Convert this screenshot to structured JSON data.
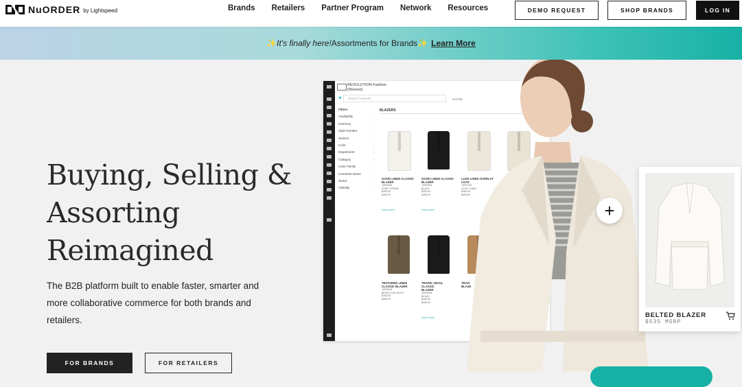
{
  "header": {
    "logo_text": "NuORDER",
    "logo_sub": "by Lightspeed",
    "nav": [
      "Brands",
      "Retailers",
      "Partner Program",
      "Network",
      "Resources"
    ],
    "demo_request": "DEMO REQUEST",
    "shop_brands": "SHOP BRANDS",
    "log_in": "LOG IN"
  },
  "banner": {
    "italic": "It's finally here!",
    "text": " Assortments for Brands",
    "learn_more": "Learn More"
  },
  "hero": {
    "title_lines": [
      "Buying, Selling &",
      "Assorting",
      "Reimagined"
    ],
    "subtitle": "The B2B platform built to enable faster, smarter and more collaborative commerce for both brands and retailers.",
    "for_brands": "FOR BRANDS",
    "for_retailers": "FOR RETAILERS"
  },
  "mock": {
    "store_line1": "REVOLUTION Fashion",
    "store_line2": "(Women)",
    "search_placeholder": "Search Products",
    "sort_by": "Sort By",
    "filters_label": "Filters",
    "filters": [
      "Availability",
      "Inventory",
      "Style Number",
      "Season",
      "Color",
      "Department",
      "Category",
      "Color Family",
      "Linesheet Name",
      "Status",
      "Visibility"
    ],
    "section": "BLAZERS",
    "products": [
      {
        "name1": "GOOD LINEN CLASSIC",
        "name2": "BLAZER",
        "sku": "J0000001",
        "color": "SHIRT CREAM",
        "wholesale": "$250.00",
        "msrp": "$495.00",
        "link": "more colors",
        "swatch": "#f4f1ea"
      },
      {
        "name1": "GOOD LINEN CLASSIC",
        "name2": "BLAZER",
        "sku": "J0000001",
        "color": "BLACK",
        "wholesale": "$250.00",
        "msrp": "$495.00",
        "link": "more colors",
        "swatch": "#1b1b1b"
      },
      {
        "name1": "LUXE LINEN OVERLAY",
        "name2": "COAT",
        "sku": "J0007001",
        "color": "LIGHT LINEN",
        "wholesale": "$250.00",
        "msrp": "$495.00",
        "link": "",
        "swatch": "#ece7d8"
      },
      {
        "name1": "",
        "name2": "",
        "sku": "",
        "color": "",
        "wholesale": "",
        "msrp": "",
        "link": "",
        "swatch": "#e8e3d3"
      },
      {
        "name1": "TEXTURED LINEN",
        "name2": "CLASSIC BLAZER",
        "sku": "J0000001",
        "color": "BEIGE CLAY MULTI",
        "wholesale": "$250.00",
        "msrp": "$495.00",
        "link": "",
        "swatch": "#6a5a45"
      },
      {
        "name1": "TRAVEL WOOL CLASSIC",
        "name2": "BLAZER",
        "sku": "J0000001",
        "color": "BLACK",
        "wholesale": "$250.00",
        "msrp": "$495.00",
        "link": "more colors",
        "swatch": "#1a1a1a"
      },
      {
        "name1": "TRAVI",
        "name2": "BLAZE",
        "sku": "",
        "color": "",
        "wholesale": "",
        "msrp": "",
        "link": "",
        "swatch": "#b68a5a"
      }
    ]
  },
  "card": {
    "name": "BELTED BLAZER",
    "price": "$535 MSRP"
  },
  "colors": {
    "banner_start": "#bcd3e6",
    "banner_end": "#17b1a5",
    "dark": "#111111"
  }
}
